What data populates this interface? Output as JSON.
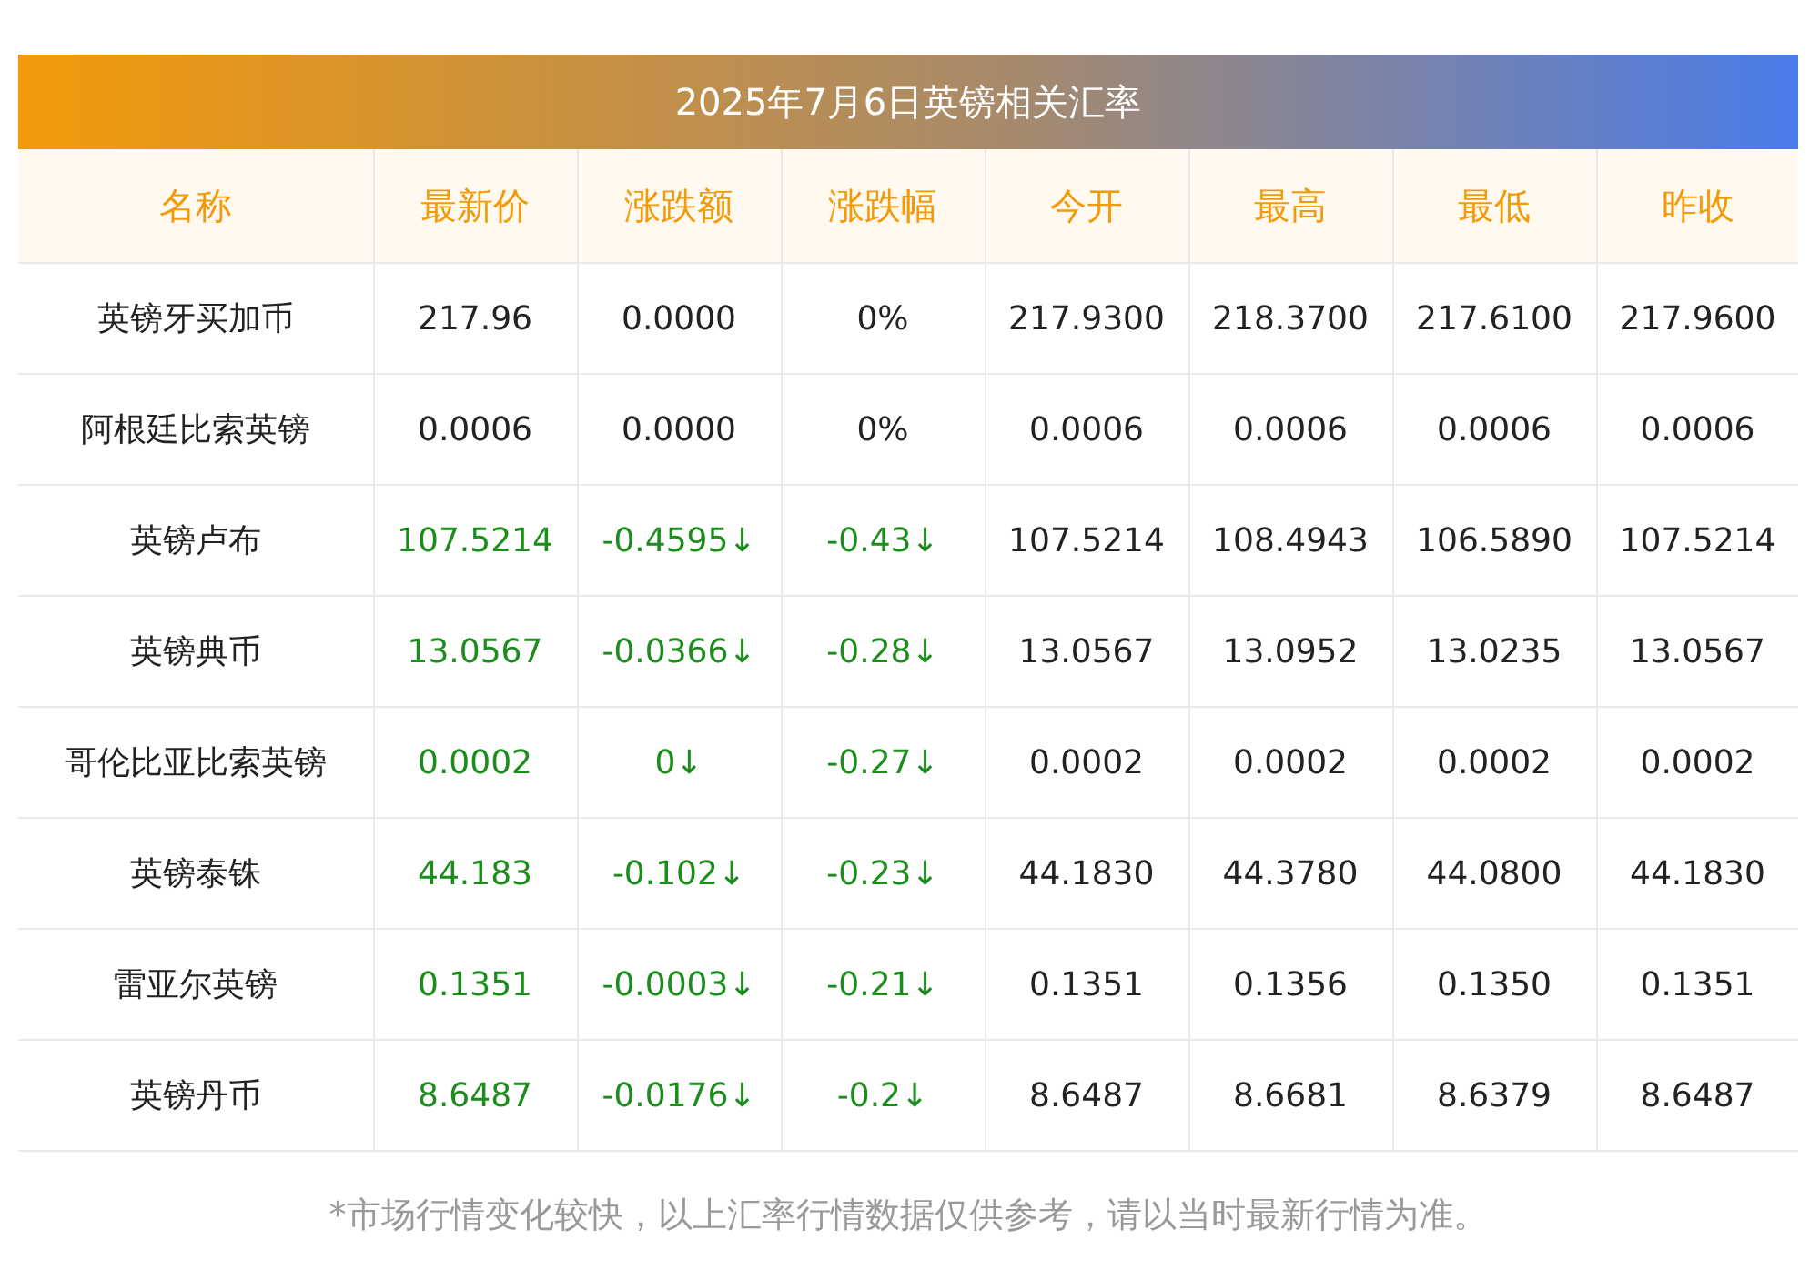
{
  "title": "2025年7月6日英镑相关汇率",
  "columns": [
    "名称",
    "最新价",
    "涨跌额",
    "涨跌幅",
    "今开",
    "最高",
    "最低",
    "昨收"
  ],
  "rows": [
    {
      "color": "#222222",
      "cells": [
        "英镑牙买加币",
        "217.96",
        "0.0000",
        "0%",
        "217.9300",
        "218.3700",
        "217.6100",
        "217.9600"
      ]
    },
    {
      "color": "#222222",
      "cells": [
        "阿根廷比索英镑",
        "0.0006",
        "0.0000",
        "0%",
        "0.0006",
        "0.0006",
        "0.0006",
        "0.0006"
      ]
    },
    {
      "color": "#1c8c1c",
      "cells": [
        "英镑卢布",
        "107.5214",
        "-0.4595↓",
        "-0.43↓",
        "107.5214",
        "108.4943",
        "106.5890",
        "107.5214"
      ]
    },
    {
      "color": "#1c8c1c",
      "cells": [
        "英镑典币",
        "13.0567",
        "-0.0366↓",
        "-0.28↓",
        "13.0567",
        "13.0952",
        "13.0235",
        "13.0567"
      ]
    },
    {
      "color": "#1c8c1c",
      "cells": [
        "哥伦比亚比索英镑",
        "0.0002",
        "0↓",
        "-0.27↓",
        "0.0002",
        "0.0002",
        "0.0002",
        "0.0002"
      ]
    },
    {
      "color": "#1c8c1c",
      "cells": [
        "英镑泰铢",
        "44.183",
        "-0.102↓",
        "-0.23↓",
        "44.1830",
        "44.3780",
        "44.0800",
        "44.1830"
      ]
    },
    {
      "color": "#1c8c1c",
      "cells": [
        "雷亚尔英镑",
        "0.1351",
        "-0.0003↓",
        "-0.21↓",
        "0.1351",
        "0.1356",
        "0.1350",
        "0.1351"
      ]
    },
    {
      "color": "#1c8c1c",
      "cells": [
        "英镑丹币",
        "8.6487",
        "-0.0176↓",
        "-0.2↓",
        "8.6487",
        "8.6681",
        "8.6379",
        "8.6487"
      ]
    }
  ],
  "footnote": "*市场行情变化较快，以上汇率行情数据仅供参考，请以当时最新行情为准。"
}
